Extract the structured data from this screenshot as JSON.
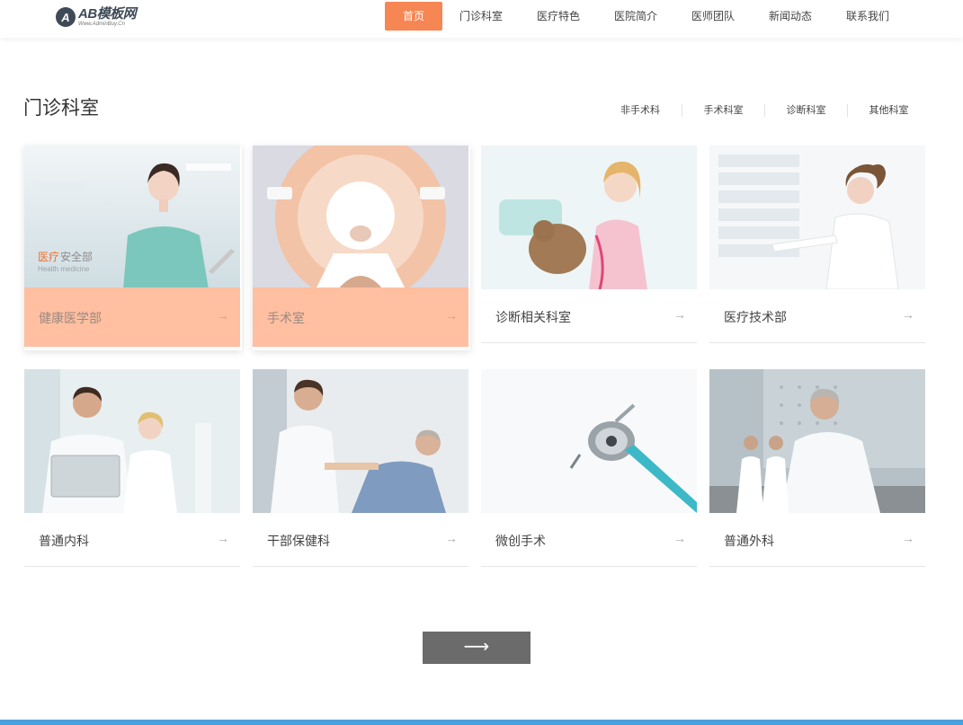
{
  "header": {
    "logo_mark": "A",
    "logo_text": "AB模板网",
    "logo_sub": "Www.AdminBuy.Cn",
    "nav": [
      {
        "label": "首页",
        "active": true
      },
      {
        "label": "门诊科室"
      },
      {
        "label": "医疗特色"
      },
      {
        "label": "医院简介"
      },
      {
        "label": "医师团队"
      },
      {
        "label": "新闻动态"
      },
      {
        "label": "联系我们"
      }
    ]
  },
  "section": {
    "title": "门诊科室",
    "tabs": [
      "非手术科",
      "手术科室",
      "诊断科室",
      "其他科室"
    ]
  },
  "cards": [
    {
      "name": "健康医学部",
      "highlight": true,
      "overlay_accent": "医疗",
      "overlay_text": "安全部",
      "overlay_sub": "Health medicine"
    },
    {
      "name": "手术室",
      "highlight": true
    },
    {
      "name": "诊断相关科室"
    },
    {
      "name": "医疗技术部"
    },
    {
      "name": "普通内科"
    },
    {
      "name": "干部保健科"
    },
    {
      "name": "微创手术"
    },
    {
      "name": "普通外科"
    }
  ],
  "arrow_glyph": "→",
  "pager": {
    "arrow_glyph": "⟶"
  },
  "colors": {
    "accent": "#f68653",
    "card_highlight": "#ffbfa0",
    "bottom_bar": "#4aa0dc",
    "pager_bg": "#6b6b6b"
  }
}
